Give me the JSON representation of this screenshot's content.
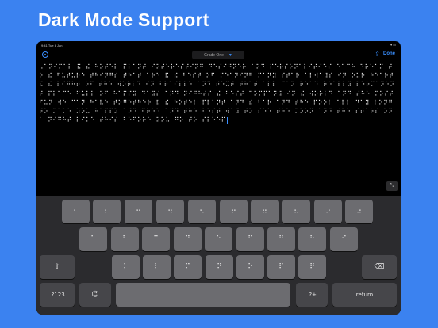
{
  "headline": "Dark Mode Support",
  "status": {
    "time": "9:41",
    "date": "Tue 8 Jan",
    "right": "▾ ▭"
  },
  "nav": {
    "grade_label": "Grade One",
    "done_label": "Done"
  },
  "editor": {
    "text": "⠠⠁⠝⠊⠍⠁⠇ ⠯ ⠮ ⠓⠕⠞⠑⠇ ⠏⠇⠁⠝⠞ ⠊⠝⠞⠑⠗⠑⠎⠞⠊⠝⠛ ⠙⠑⠎⠊⠛⠝⠑⠗ ⠁⠝⠙ ⠏⠑⠗⠎⠕⠝⠁⠇⠊⠞⠊⠑⠎ ⠑⠁⠉⠓ ⠙⠗⠑⠁⠍ ⠞⠕ ⠮ ⠋⠥⠞⠥⠗⠑ ⠞⠓⠊⠝⠛⠎ ⠞⠓⠁⠞ ⠁⠗⠑ ⠯ ⠮ ⠃⠑⠎⠞ ⠕⠋ ⠍⠑⠁⠝⠊⠝⠛ ⠍⠁⠝⠽ ⠎⠞⠁⠗ ⠁⠇⠺⠁⠽⠎ ⠊⠝ ⠕⠥⠗ ⠓⠑⠁⠗⠞ ⠯ ⠮ ⠇⠊⠛⠓⠞ ⠕⠋ ⠞⠓⠑ ⠺⠕⠗⠇⠙ ⠊⠝ ⠃⠗⠁⠊⠇⠇⠑ ⠁⠝⠙ ⠞⠑⠭⠞ ⠞⠓⠁⠞ ⠁⠇⠇ ⠉⠁⠝ ⠗⠑⠁⠙ ⠗⠑⠁⠇⠇⠽ ⠏⠑⠗⠍⠁⠝⠑⠝⠞ ⠏⠇⠁⠉⠑ ⠋⠥⠇⠇ ⠕⠋ ⠓⠁⠏⠏⠽ ⠙⠁⠽⠎ ⠁⠝⠙ ⠝⠊⠛⠓⠞⠎ ⠮ ⠃⠑⠎⠞ ⠉⠕⠍⠏⠁⠝⠽ ⠊⠝ ⠮ ⠺⠕⠗⠇⠙ ⠁⠝⠙ ⠞⠓⠑ ⠍⠕⠎⠞ ⠋⠥⠝ ⠺⠑ ⠉⠁⠝ ⠓⠁⠧⠑ ⠞⠕⠛⠑⠞⠓⠑⠗ ⠯ ⠮ ⠓⠕⠞⠑⠇ ⠏⠇⠁⠝⠞ ⠁⠝⠙ ⠮ ⠃⠁⠗ ⠁⠝⠙ ⠞⠓⠑ ⠏⠕⠕⠇ ⠁⠇⠇ ⠙⠁⠽ ⠇⠕⠝⠛ ⠞⠕ ⠍⠁⠅⠑ ⠽⠕⠥ ⠓⠁⠏⠏⠽ ⠁⠝⠙ ⠋⠗⠑⠑ ⠁⠝⠙ ⠞⠓⠑ ⠃⠑⠎⠞ ⠺⠁⠽ ⠞⠕ ⠎⠑⠑ ⠞⠓⠑ ⠍⠕⠕⠝ ⠁⠝⠙ ⠞⠓⠑ ⠎⠞⠁⠗⠎ ⠕⠝ ⠁ ⠝⠊⠛⠓⠞ ⠇⠊⠅⠑ ⠞⠓⠊⠎ ⠃⠑⠋⠕⠗⠑ ⠽⠕⠥ ⠛⠕ ⠞⠕ ⠎⠇⠑⠑⠏"
  },
  "keyboard": {
    "row1": [
      "⠂",
      "⠆",
      "⠒",
      "⠲",
      "⠢",
      "⠖",
      "⠶",
      "⠦",
      "⠔",
      "⠴"
    ],
    "row2": [
      "⠁",
      "⠃",
      "⠉",
      "⠙",
      "⠑",
      "⠋",
      "⠛",
      "⠓",
      "⠊"
    ],
    "row3": [
      "⠅",
      "⠇",
      "⠍",
      "⠝",
      "⠕",
      "⠏",
      "⠟"
    ],
    "shift_label": "⇧",
    "delete_label": "⌫",
    "numbers_label": ".?123",
    "emoji_label": "☺",
    "space_label": "",
    "alt_label": ".?+",
    "return_label": "return",
    "dismiss_label": "⤡"
  }
}
